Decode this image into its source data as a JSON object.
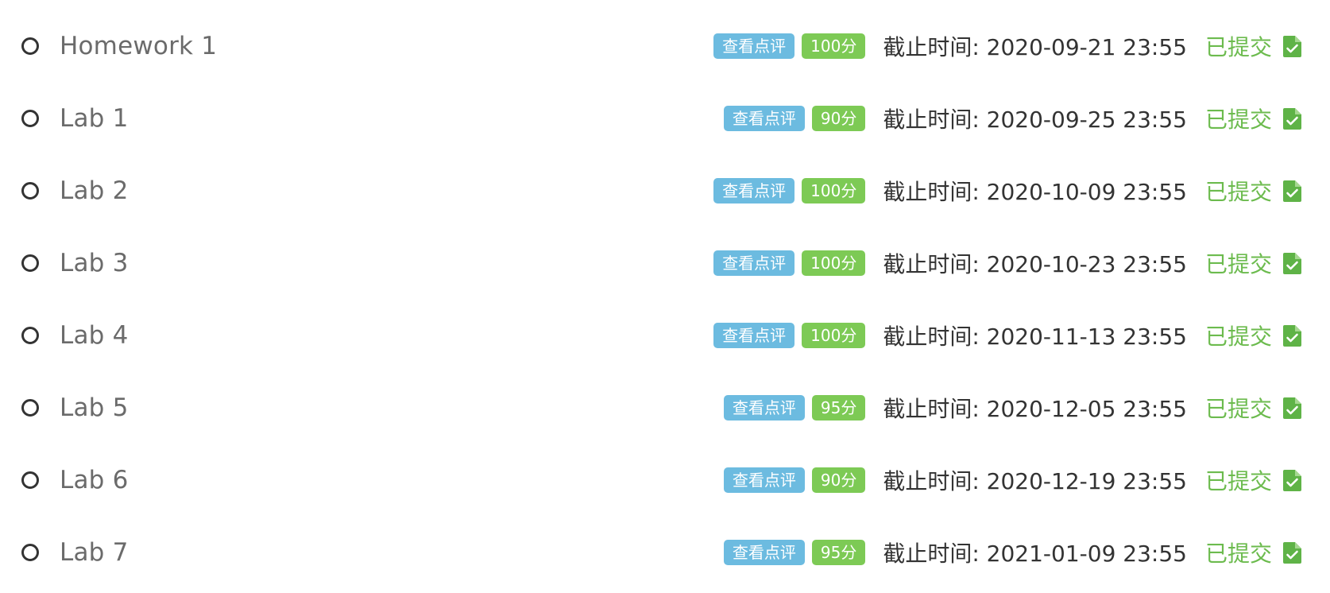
{
  "colors": {
    "review_badge": "#6cbbe0",
    "score_badge": "#7dca55",
    "submitted_text": "#6cbb4e",
    "file_icon": "#5fb347"
  },
  "assignments": [
    {
      "title": "Homework 1",
      "review_label": "查看点评",
      "score": "100分",
      "deadline": "截止时间: 2020-09-21 23:55",
      "status": "已提交",
      "icon": "submitted-file-check-icon"
    },
    {
      "title": "Lab 1",
      "review_label": "查看点评",
      "score": "90分",
      "deadline": "截止时间: 2020-09-25 23:55",
      "status": "已提交",
      "icon": "submitted-file-check-icon"
    },
    {
      "title": "Lab 2",
      "review_label": "查看点评",
      "score": "100分",
      "deadline": "截止时间: 2020-10-09 23:55",
      "status": "已提交",
      "icon": "submitted-file-check-icon"
    },
    {
      "title": "Lab 3",
      "review_label": "查看点评",
      "score": "100分",
      "deadline": "截止时间: 2020-10-23 23:55",
      "status": "已提交",
      "icon": "submitted-file-check-icon"
    },
    {
      "title": "Lab 4",
      "review_label": "查看点评",
      "score": "100分",
      "deadline": "截止时间: 2020-11-13 23:55",
      "status": "已提交",
      "icon": "submitted-file-check-icon"
    },
    {
      "title": "Lab 5",
      "review_label": "查看点评",
      "score": "95分",
      "deadline": "截止时间: 2020-12-05 23:55",
      "status": "已提交",
      "icon": "submitted-file-check-icon"
    },
    {
      "title": "Lab 6",
      "review_label": "查看点评",
      "score": "90分",
      "deadline": "截止时间: 2020-12-19 23:55",
      "status": "已提交",
      "icon": "submitted-file-check-icon"
    },
    {
      "title": "Lab 7",
      "review_label": "查看点评",
      "score": "95分",
      "deadline": "截止时间: 2021-01-09 23:55",
      "status": "已提交",
      "icon": "submitted-file-check-icon"
    }
  ]
}
